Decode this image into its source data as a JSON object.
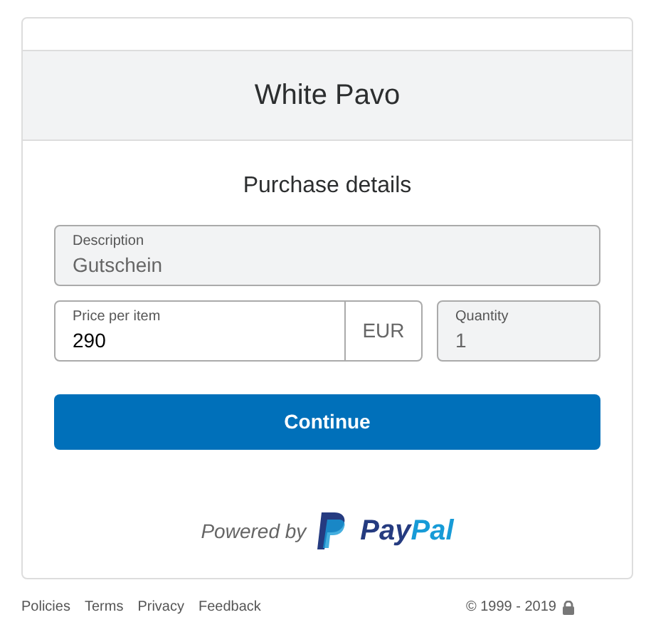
{
  "merchant": "White Pavo",
  "heading": "Purchase details",
  "fields": {
    "description": {
      "label": "Description",
      "value": "Gutschein",
      "disabled": true
    },
    "price": {
      "label": "Price per item",
      "value": "290",
      "disabled": false,
      "currency": "EUR"
    },
    "quantity": {
      "label": "Quantity",
      "value": "1",
      "disabled": true
    }
  },
  "button": "Continue",
  "powered_by": "Powered by",
  "logo": {
    "first": "Pay",
    "second": "Pal"
  },
  "footer_links": [
    "Policies",
    "Terms",
    "Privacy",
    "Feedback"
  ],
  "copyright": "© 1999 - 2019"
}
